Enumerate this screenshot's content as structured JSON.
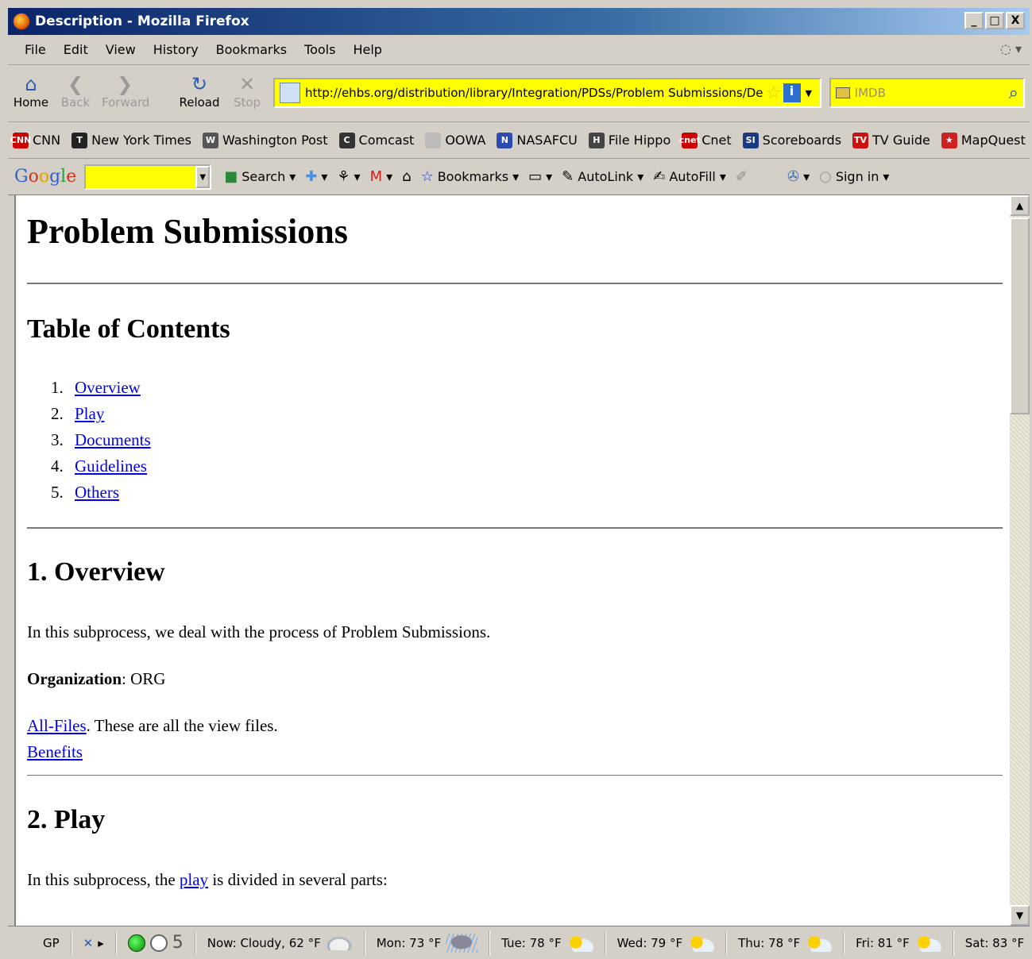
{
  "window": {
    "title": "Description - Mozilla Firefox",
    "controls": [
      "_",
      "□",
      "X"
    ]
  },
  "menu": [
    "File",
    "Edit",
    "View",
    "History",
    "Bookmarks",
    "Tools",
    "Help"
  ],
  "navigation": {
    "home": "Home",
    "back": "Back",
    "forward": "Forward",
    "reload": "Reload",
    "stop": "Stop",
    "url": "http://ehbs.org/distribution/library/Integration/PDSs/Problem Submissions/De",
    "search_placeholder": "IMDB"
  },
  "bookmarks": [
    {
      "label": "CNN",
      "icon": "cnn-icon",
      "color": "#cc0000",
      "glyph": "CNN"
    },
    {
      "label": "New York Times",
      "icon": "nyt-icon",
      "color": "#222222",
      "glyph": "T"
    },
    {
      "label": "Washington Post",
      "icon": "wapo-icon",
      "color": "#555555",
      "glyph": "W"
    },
    {
      "label": "Comcast",
      "icon": "comcast-icon",
      "color": "#333333",
      "glyph": "C"
    },
    {
      "label": "OOWA",
      "icon": "page-icon",
      "color": "#bbbbbb",
      "glyph": ""
    },
    {
      "label": "NASAFCU",
      "icon": "nasafcu-icon",
      "color": "#2a4cb0",
      "glyph": "N"
    },
    {
      "label": "File Hippo",
      "icon": "filehippo-icon",
      "color": "#444444",
      "glyph": "H"
    },
    {
      "label": "Cnet",
      "icon": "cnet-icon",
      "color": "#cc0000",
      "glyph": "cnet"
    },
    {
      "label": "Scoreboards",
      "icon": "si-icon",
      "color": "#1a3a80",
      "glyph": "SI"
    },
    {
      "label": "TV Guide",
      "icon": "tvguide-icon",
      "color": "#cc1111",
      "glyph": "TV"
    },
    {
      "label": "MapQuest",
      "icon": "mapquest-icon",
      "color": "#cc2222",
      "glyph": "★"
    }
  ],
  "google_toolbar": {
    "logo": [
      "G",
      "o",
      "o",
      "g",
      "l",
      "e"
    ],
    "search": "Search",
    "bookmarks": "Bookmarks",
    "autolink": "AutoLink",
    "autofill": "AutoFill",
    "signin": "Sign in"
  },
  "page": {
    "title": "Problem Submissions",
    "toc_heading": "Table of Contents",
    "toc": [
      {
        "num": "1.",
        "label": "Overview"
      },
      {
        "num": "2.",
        "label": "Play"
      },
      {
        "num": "3.",
        "label": "Documents"
      },
      {
        "num": "4.",
        "label": "Guidelines"
      },
      {
        "num": "5.",
        "label": "Others"
      }
    ],
    "overview": {
      "heading": "1. Overview",
      "intro": "In this subprocess, we deal with the process of Problem Submissions.",
      "org_label": "Organization",
      "org_value": ": ORG",
      "all_files_link": "All-Files",
      "all_files_text": ". These are all the view files.",
      "benefits_link": "Benefits"
    },
    "play": {
      "heading": "2. Play",
      "intro_before": "In this subprocess, the ",
      "intro_link": "play",
      "intro_after": " is divided in several parts:"
    }
  },
  "statusbar": {
    "gp": "GP",
    "count": "5",
    "now": "Now: Cloudy, 62 °F",
    "forecast": [
      {
        "label": "Mon: 73 °F",
        "icon": "rain-icon"
      },
      {
        "label": "Tue: 78 °F",
        "icon": "sun-icon"
      },
      {
        "label": "Wed: 79 °F",
        "icon": "sun-icon"
      },
      {
        "label": "Thu: 78 °F",
        "icon": "sun-icon"
      },
      {
        "label": "Fri: 81 °F",
        "icon": "sun-icon"
      },
      {
        "label": "Sat: 83 °F",
        "icon": "sun-icon"
      }
    ]
  }
}
